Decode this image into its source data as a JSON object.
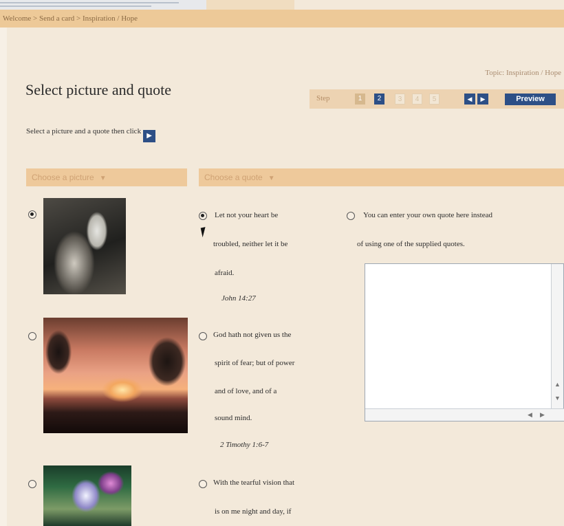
{
  "breadcrumb": {
    "text": "Welcome > Send a card > Inspiration / Hope"
  },
  "topic": {
    "text": "Topic: Inspiration / Hope"
  },
  "page": {
    "title": "Select picture and quote",
    "instruction": "Select a picture and a quote then click"
  },
  "steps": {
    "label": "Step",
    "items": [
      {
        "label": "1",
        "state": "done"
      },
      {
        "label": "2",
        "state": "current"
      },
      {
        "label": "3",
        "state": "pending"
      },
      {
        "label": "4",
        "state": "pending"
      },
      {
        "label": "5",
        "state": "pending"
      }
    ],
    "preview_label": "Preview",
    "prev_icon": "chevron-left-icon",
    "next_icon": "chevron-right-icon"
  },
  "dropdowns": {
    "picture": "Choose a picture",
    "quote": "Choose a quote"
  },
  "pictures": [
    {
      "selected": true,
      "image": "woman-in-white-headscarf-photo"
    },
    {
      "selected": false,
      "image": "sunset-trees-photo"
    },
    {
      "selected": false,
      "image": "child-in-garden-photo"
    }
  ],
  "quotes": [
    {
      "selected": true,
      "lines": [
        "Let not your heart be",
        "troubled, neither let it be",
        "afraid."
      ],
      "ref": "John 14:27"
    },
    {
      "selected": false,
      "lines": [
        "God hath not given us the",
        "spirit of fear; but of power",
        "and of love, and of a",
        "sound mind."
      ],
      "ref": "2 Timothy 1:6-7"
    },
    {
      "selected": false,
      "lines": [
        "With the tearful vision that",
        "is on me night and day, if"
      ],
      "ref": ""
    }
  ],
  "custom_quote": {
    "selected": false,
    "label_lines": [
      "You can enter your own quote here instead",
      "of using one of the supplied quotes."
    ],
    "value": ""
  },
  "colors": {
    "accent": "#2d4f86",
    "breadcrumb_bg": "#edc998",
    "page_bg": "#f3e9da",
    "dropdown_bg": "#eec99b"
  }
}
